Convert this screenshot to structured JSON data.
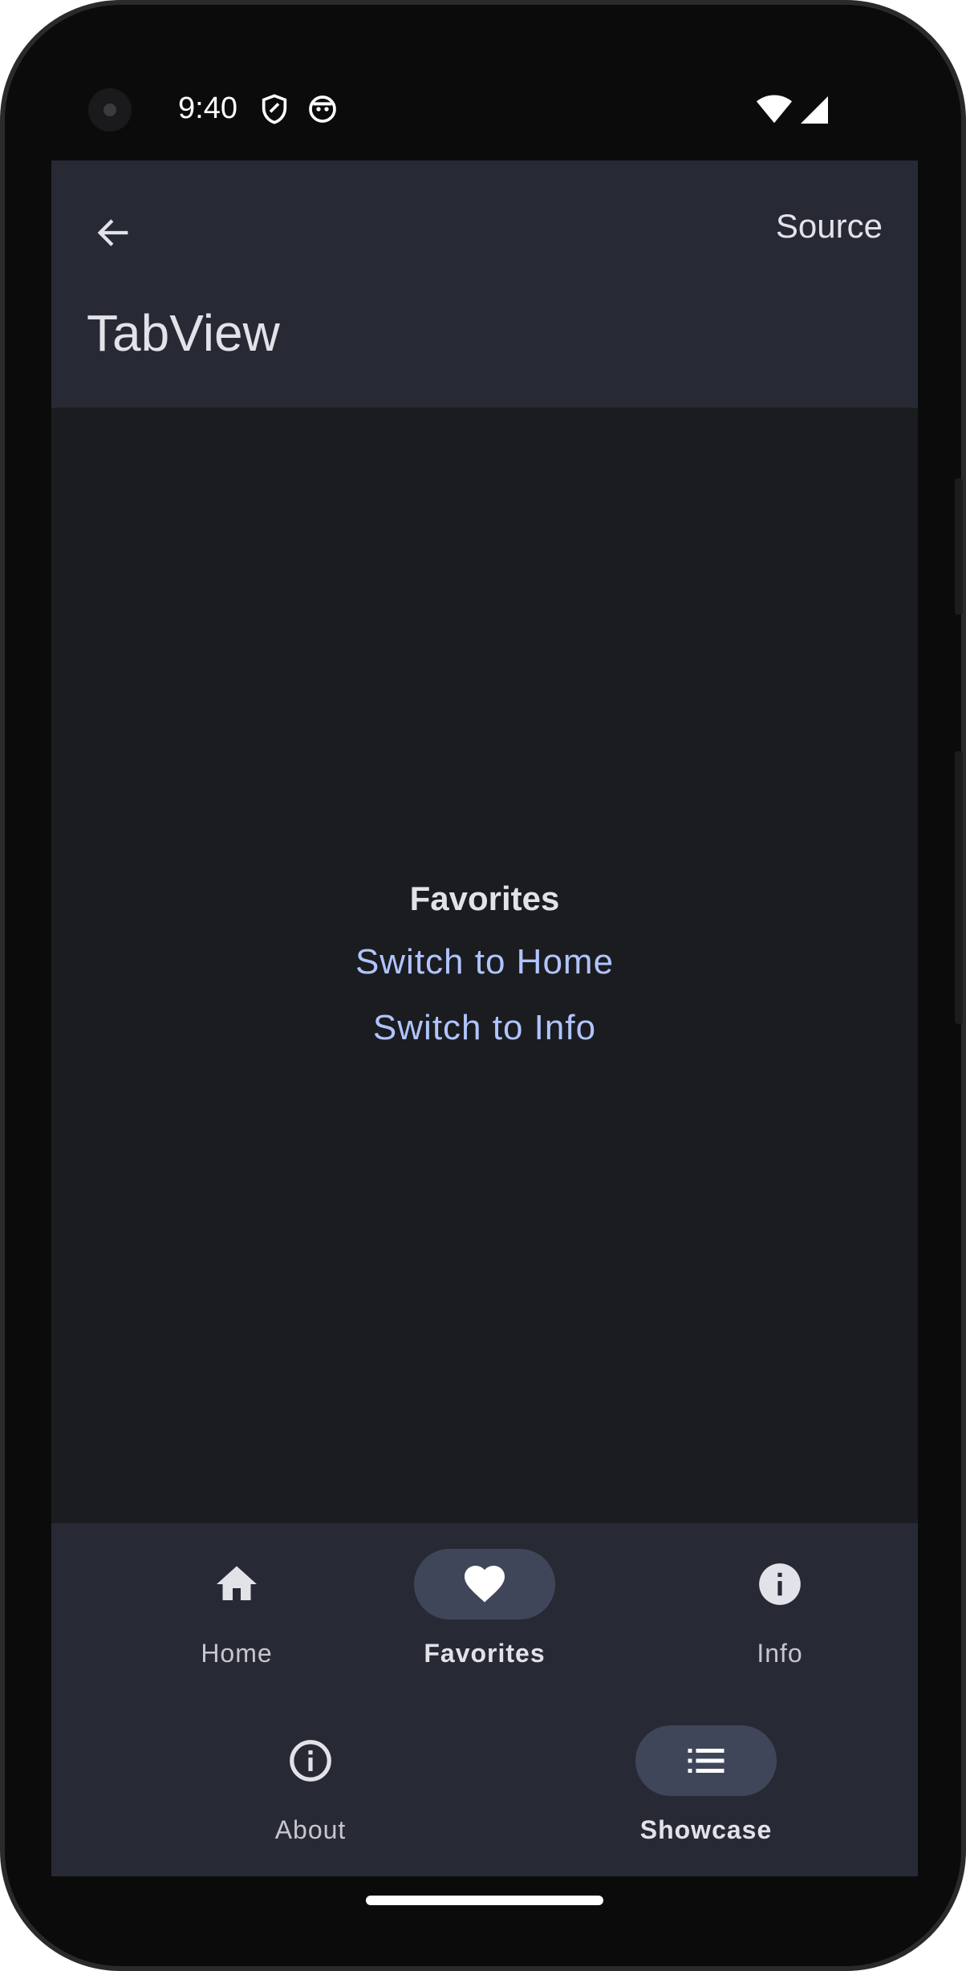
{
  "status_bar": {
    "time": "9:40",
    "icons": [
      "shield-icon",
      "app-face-icon",
      "wifi-icon",
      "cellular-signal-icon"
    ]
  },
  "app_bar": {
    "back_icon": "arrow-back-icon",
    "action_label": "Source",
    "title": "TabView"
  },
  "content": {
    "title": "Favorites",
    "links": [
      "Switch to Home",
      "Switch to Info"
    ]
  },
  "tabs_row1": [
    {
      "label": "Home",
      "icon": "home-icon",
      "active": false
    },
    {
      "label": "Favorites",
      "icon": "heart-icon",
      "active": true
    },
    {
      "label": "Info",
      "icon": "info-filled-icon",
      "active": false
    }
  ],
  "tabs_row2": [
    {
      "label": "About",
      "icon": "info-outline-icon",
      "active": false
    },
    {
      "label": "Showcase",
      "icon": "list-icon",
      "active": true
    }
  ],
  "colors": {
    "app_bar": "#272a34",
    "background": "#1b1c20",
    "link": "#b0c4ff",
    "active_pill": "#404659"
  }
}
